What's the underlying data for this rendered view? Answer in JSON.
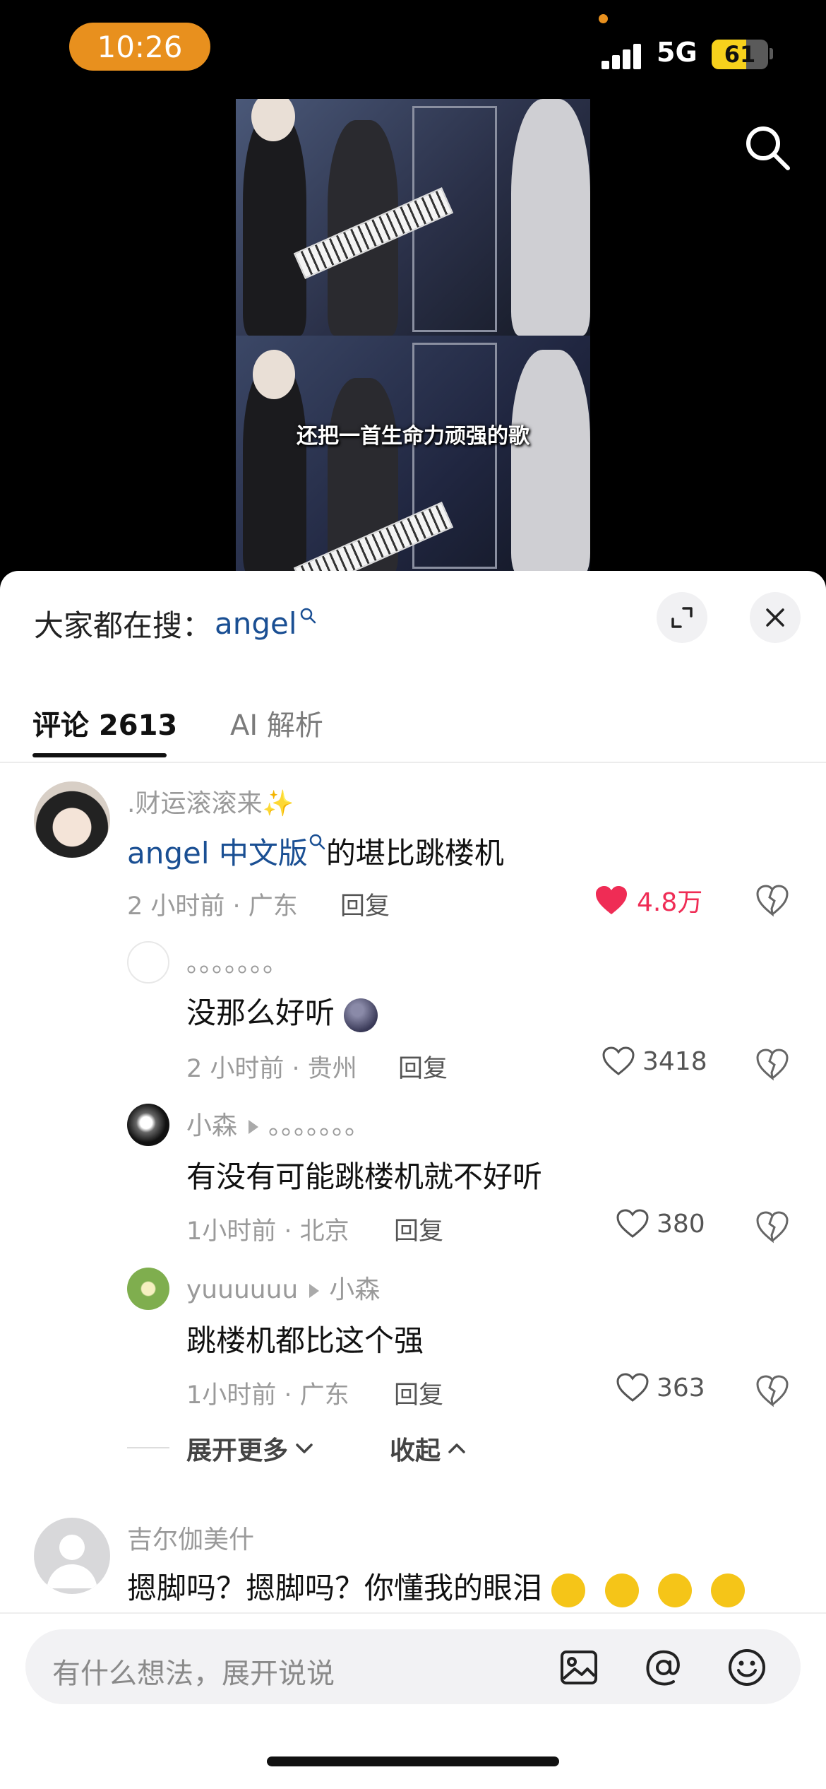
{
  "status_bar": {
    "time": "10:26",
    "network": "5G",
    "battery": "61",
    "battery_level": 0.61
  },
  "video": {
    "subtitle": "还把一首生命力顽强的歌"
  },
  "search_hint": {
    "prefix": "大家都在搜：",
    "keyword": "angel"
  },
  "tabs": [
    {
      "label": "评论 2613",
      "active": true
    },
    {
      "label": "AI 解析",
      "active": false
    }
  ],
  "comments": [
    {
      "username": ".财运滚滚来✨",
      "keyword": "angel 中文版",
      "text": "的堪比跳楼机",
      "meta": "2 小时前 · 广东",
      "reply": "回复",
      "likes": "4.8万",
      "liked": true
    },
    {
      "username": "。。。。。。。",
      "text": "没那么好听",
      "meta": "2 小时前 · 贵州",
      "reply": "回复",
      "likes": "3418"
    },
    {
      "username": "小森",
      "reply_to": "。。。。。。。",
      "text": "有没有可能跳楼机就不好听",
      "meta": "1小时前 · 北京",
      "reply": "回复",
      "likes": "380"
    },
    {
      "username": "yuuuuuu",
      "reply_to": "小森",
      "text": "跳楼机都比这个强",
      "meta": "1小时前 · 广东",
      "reply": "回复",
      "likes": "363"
    },
    {
      "username": "吉尔伽美什",
      "text": "摁脚吗？摁脚吗？你懂我的眼泪"
    }
  ],
  "thread_controls": {
    "expand": "展开更多",
    "collapse": "收起"
  },
  "input": {
    "placeholder": "有什么想法，展开说说"
  },
  "colors": {
    "accent": "#ef2c55",
    "link": "#1a4f93",
    "time_pill": "#e8901e",
    "battery": "#f7d11c"
  }
}
